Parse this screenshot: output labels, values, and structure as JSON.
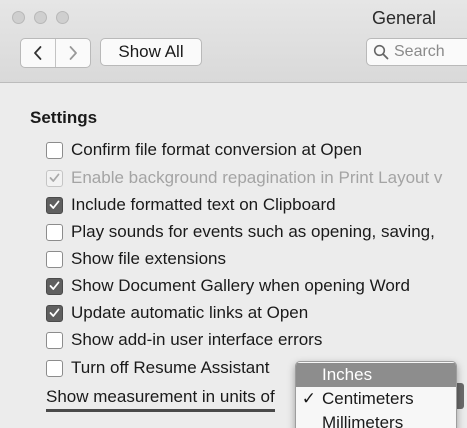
{
  "window": {
    "title": "General"
  },
  "toolbar": {
    "back_icon": "chevron-left-icon",
    "forward_icon": "chevron-right-icon",
    "show_all_label": "Show All",
    "search_placeholder": "Search"
  },
  "settings": {
    "heading": "Settings",
    "items": [
      {
        "label": "Confirm file format conversion at Open",
        "checked": false,
        "enabled": true
      },
      {
        "label": "Enable background repagination in Print Layout v",
        "checked": true,
        "enabled": false
      },
      {
        "label": "Include formatted text on Clipboard",
        "checked": true,
        "enabled": true
      },
      {
        "label": "Play sounds for events such as opening, saving,",
        "checked": false,
        "enabled": true
      },
      {
        "label": "Show file extensions",
        "checked": false,
        "enabled": true
      },
      {
        "label": "Show Document Gallery when opening Word",
        "checked": true,
        "enabled": true
      },
      {
        "label": "Update automatic links at Open",
        "checked": true,
        "enabled": true
      },
      {
        "label": "Show add-in user interface errors",
        "checked": false,
        "enabled": true
      },
      {
        "label": "Turn off Resume Assistant",
        "checked": false,
        "enabled": true
      }
    ],
    "measurement_label": "Show measurement in units of"
  },
  "units_menu": {
    "options": [
      {
        "label": "Inches",
        "checkmark": "",
        "highlighted": true
      },
      {
        "label": "Centimeters",
        "checkmark": "✓",
        "highlighted": false
      },
      {
        "label": "Millimeters",
        "checkmark": "",
        "highlighted": false
      }
    ]
  },
  "colors": {
    "window_bg": "#ececec",
    "checkbox_checked": "#5f5f5f",
    "menu_highlight": "#8d8d8d"
  }
}
